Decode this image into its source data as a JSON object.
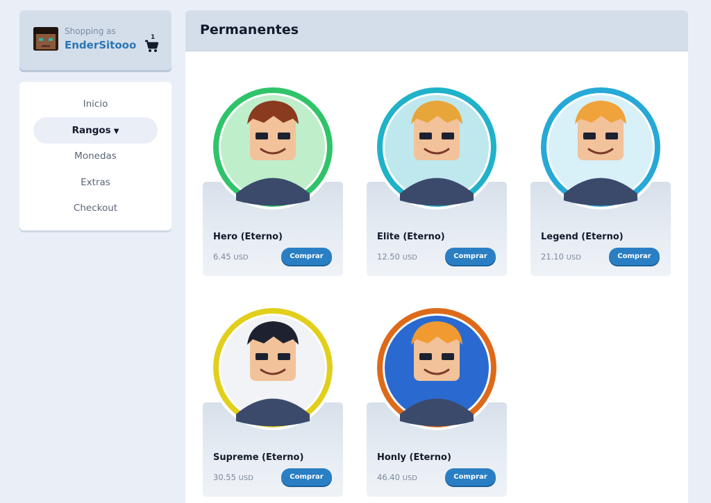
{
  "user": {
    "shopping_label": "Shopping as",
    "username": "EnderSitooo",
    "cart_count": "1"
  },
  "nav": {
    "items": [
      {
        "label": "Inicio"
      },
      {
        "label": "Rangos"
      },
      {
        "label": "Monedas"
      },
      {
        "label": "Extras"
      },
      {
        "label": "Checkout"
      }
    ],
    "active_index": 1
  },
  "main": {
    "title": "Permanentes",
    "buy_label": "Comprar",
    "products": [
      {
        "name": "Hero (Eterno)",
        "price": "6.45",
        "currency": "USD",
        "ring_color": "#2fc46a",
        "bg_color": "#bfeecb",
        "hair_color": "#8a3a1e"
      },
      {
        "name": "Elite (Eterno)",
        "price": "12.50",
        "currency": "USD",
        "ring_color": "#1fb2c9",
        "bg_color": "#bfe8ee",
        "hair_color": "#e7a53a"
      },
      {
        "name": "Legend (Eterno)",
        "price": "21.10",
        "currency": "USD",
        "ring_color": "#26a9d6",
        "bg_color": "#d8f0f8",
        "hair_color": "#f0a33b"
      },
      {
        "name": "Supreme (Eterno)",
        "price": "30.55",
        "currency": "USD",
        "ring_color": "#e2cf1c",
        "bg_color": "#f1f3f6",
        "hair_color": "#1e2230"
      },
      {
        "name": "Honly (Eterno)",
        "price": "46.40",
        "currency": "USD",
        "ring_color": "#dd6a1a",
        "bg_color": "#2a6ad0",
        "hair_color": "#f09a30"
      }
    ]
  }
}
